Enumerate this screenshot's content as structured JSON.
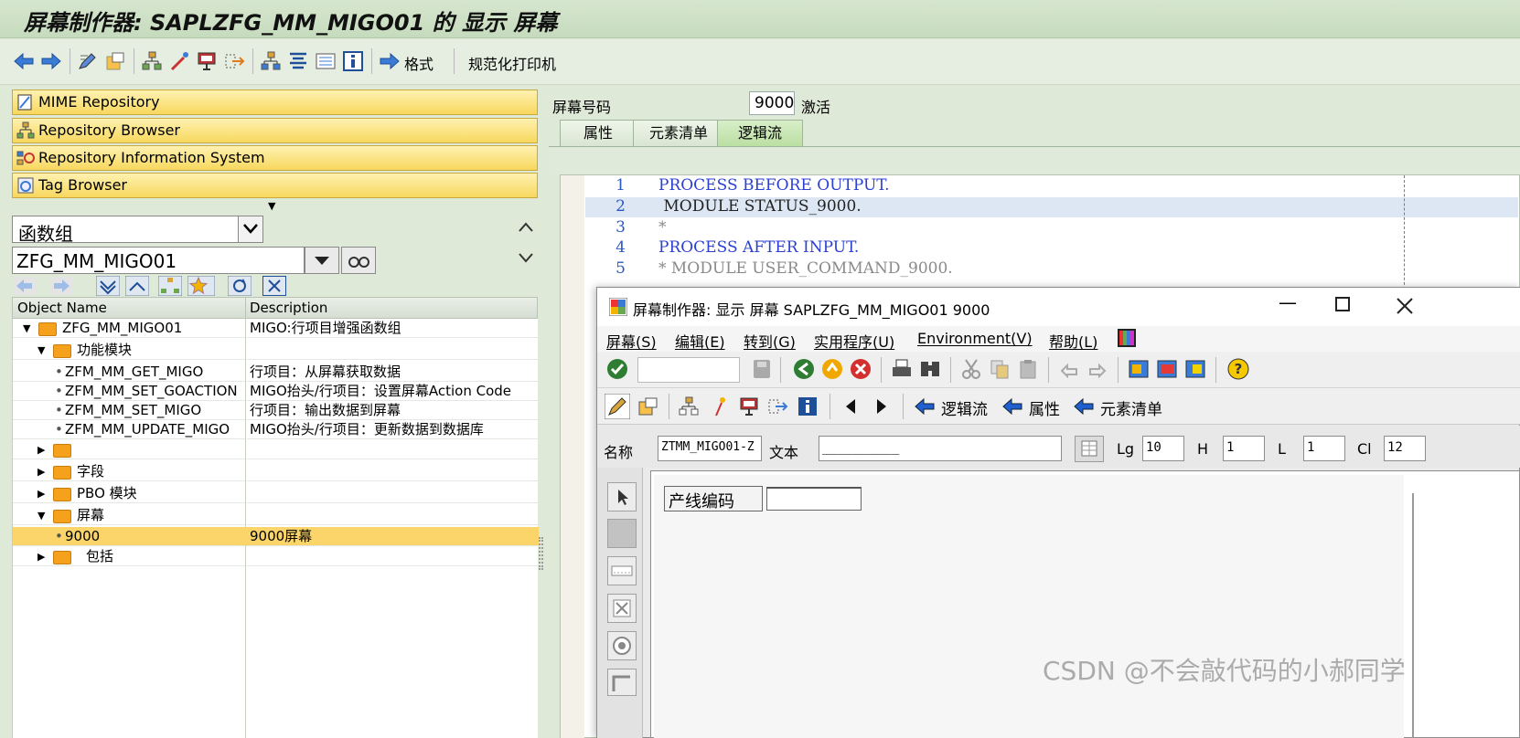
{
  "window_title": "屏幕制作器: SAPLZFG_MM_MIGO01 的 显示 屏幕",
  "toolbar": {
    "format_label": "格式",
    "print_label": "规范化打印机"
  },
  "object_navigator": {
    "nav_buttons": [
      "MIME Repository",
      "Repository Browser",
      "Repository Information System",
      "Tag Browser"
    ],
    "object_type": "函数组",
    "object_name_value": "ZFG_MM_MIGO01",
    "tree_columns": [
      "Object Name",
      "Description"
    ],
    "tree": [
      {
        "name": "ZFG_MM_MIGO01",
        "desc": "MIGO:行项目增强函数组"
      },
      {
        "name": "功能模块",
        "desc": ""
      },
      {
        "name": "ZFM_MM_GET_MIGO",
        "desc": "行项目：从屏幕获取数据"
      },
      {
        "name": "ZFM_MM_SET_GOACTION",
        "desc": "MIGO抬头/行项目：设置屏幕Action Code"
      },
      {
        "name": "ZFM_MM_SET_MIGO",
        "desc": "行项目：输出数据到屏幕"
      },
      {
        "name": "ZFM_MM_UPDATE_MIGO",
        "desc": "MIGO抬头/行项目：更新数据到数据库"
      },
      {
        "name": "",
        "desc": ""
      },
      {
        "name": "字段",
        "desc": ""
      },
      {
        "name": "PBO 模块",
        "desc": ""
      },
      {
        "name": "屏幕",
        "desc": ""
      },
      {
        "name": "9000",
        "desc": "9000屏幕"
      },
      {
        "name": "包括",
        "desc": ""
      }
    ]
  },
  "screen_header": {
    "label": "屏幕号码",
    "number": "9000",
    "status": "激活"
  },
  "tabs": [
    "属性",
    "元素清单",
    "逻辑流"
  ],
  "active_tab": "逻辑流",
  "code_lines": [
    {
      "num": "1",
      "text": "PROCESS BEFORE OUTPUT."
    },
    {
      "num": "2",
      "text": " MODULE STATUS_9000."
    },
    {
      "num": "3",
      "text": "*"
    },
    {
      "num": "4",
      "text": "PROCESS AFTER INPUT."
    },
    {
      "num": "5",
      "text": "* MODULE USER_COMMAND_9000."
    }
  ],
  "dialog": {
    "title": "屏幕制作器:  显示 屏幕 SAPLZFG_MM_MIGO01 9000",
    "menu": [
      "屏幕(S)",
      "编辑(E)",
      "转到(G)",
      "实用程序(U)",
      "Environment(V)",
      "帮助(L)"
    ],
    "nav_buttons": [
      "逻辑流",
      "属性",
      "元素清单"
    ],
    "attrs": {
      "name_label": "名称",
      "name_value": "ZTMM_MIGO01-Z",
      "text_label": "文本",
      "text_value": "__________",
      "lg_label": "Lg",
      "lg_value": "10",
      "h_label": "H",
      "h_value": "1",
      "l_label": "L",
      "l_value": "1",
      "cl_label": "Cl",
      "cl_value": "12"
    },
    "field_label": "产线编码"
  },
  "watermark": "CSDN @不会敲代码的小郝同学",
  "colors": {
    "sap_green": "#dfe9d8",
    "nav_yellow": "#f7d75e",
    "keyword_blue": "#2b3fd1",
    "comment_gray": "#8a8a8a",
    "selected_row": "#fbd56a"
  }
}
